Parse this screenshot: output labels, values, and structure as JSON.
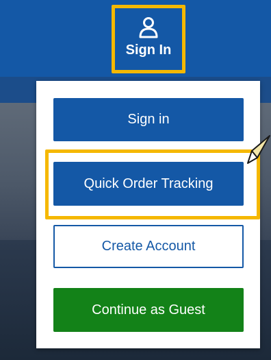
{
  "header": {
    "sign_in_label": "Sign In"
  },
  "dropdown": {
    "sign_in_button": "Sign in",
    "quick_order_tracking_button": "Quick Order Tracking",
    "create_account_button": "Create Account",
    "continue_guest_button": "Continue as Guest"
  },
  "colors": {
    "brand_blue": "#1458a6",
    "green": "#138218",
    "highlight": "#f5b800"
  },
  "icons": {
    "header_icon": "user-icon",
    "side_icon": "speech-pointer-icon"
  }
}
